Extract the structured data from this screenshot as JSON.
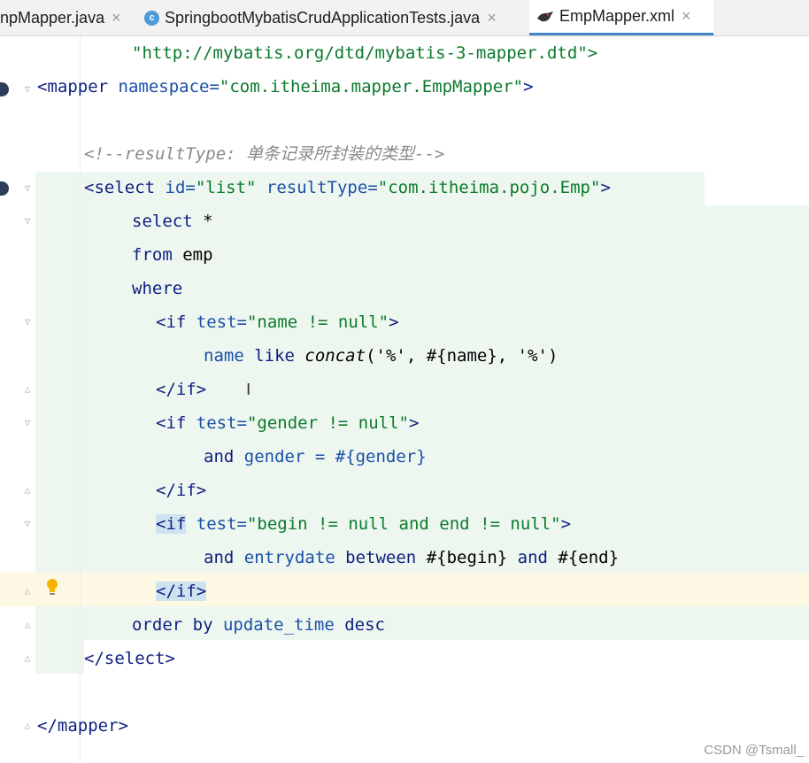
{
  "tabs": [
    {
      "label": "npMapper.java",
      "icon": "java-interface-icon",
      "active": false
    },
    {
      "label": "SpringbootMybatisCrudApplicationTests.java",
      "icon": "java-class-icon",
      "active": false
    },
    {
      "label": "EmpMapper.xml",
      "icon": "mybatis-bird-icon",
      "active": true
    }
  ],
  "close_glyph": "×",
  "class_icon_letter": "c",
  "code": {
    "l1": {
      "a": "\"http://mybatis.org/dtd/mybatis-3-mapper.dtd\">"
    },
    "l2": {
      "a": "<mapper",
      "b": " namespace=",
      "c": "\"com.itheima.mapper.EmpMapper\"",
      "d": ">"
    },
    "l3": {
      "a": "<!--resultType: 单条记录所封装的类型-->"
    },
    "l4": {
      "a": "<select",
      "b": " id=",
      "c": "\"list\"",
      "d": " resultType=",
      "e": "\"com.itheima.pojo.Emp\"",
      "f": ">"
    },
    "l5": {
      "a": "select",
      "b": " *"
    },
    "l6": {
      "a": "from",
      "b": " emp"
    },
    "l7": {
      "a": "where"
    },
    "l8": {
      "a": "<if",
      "b": " test=",
      "c": "\"name != null\"",
      "d": ">"
    },
    "l9": {
      "a": "name ",
      "b": "like",
      "c": " ",
      "d": "concat",
      "e": "('%', #{name}, '%')"
    },
    "l10": {
      "a": "</if>"
    },
    "l11": {
      "a": "<if",
      "b": " test=",
      "c": "\"gender != null\"",
      "d": ">"
    },
    "l12": {
      "a": "and",
      "b": " gender = #{gender}"
    },
    "l13": {
      "a": "</if>"
    },
    "l14": {
      "a": "<if",
      "b": " test=",
      "c": "\"begin != null and end != null\"",
      "d": ">"
    },
    "l15": {
      "a": "and",
      "b": " entrydate ",
      "c": "between",
      "d": " #{begin} ",
      "e": "and",
      "f": " #{end}"
    },
    "l16": {
      "a": "</if>"
    },
    "l17": {
      "a": "order by",
      "b": " update_time ",
      "c": "desc"
    },
    "l18": {
      "a": "</select>"
    },
    "l19": {
      "a": "</mapper>"
    }
  },
  "text_cursor": "I",
  "watermark": "CSDN @Tsmall_",
  "colors": {
    "tag": "#0d1f80",
    "string": "#0b7a2b",
    "comment": "#8a8a8a",
    "sql_band": "#eef7ef",
    "caret_line": "#fdf8e3"
  }
}
